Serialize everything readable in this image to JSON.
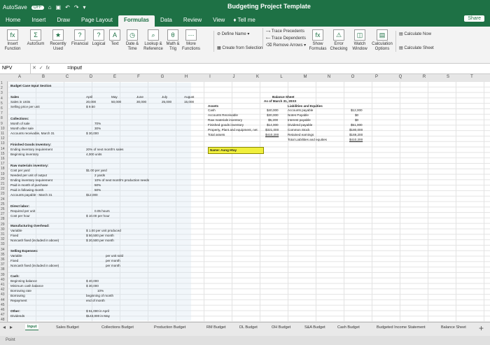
{
  "app": {
    "autosave": "AutoSave",
    "autosave_state": "OFF",
    "title": "Budgeting Project Template"
  },
  "tabs": [
    "Home",
    "Insert",
    "Draw",
    "Page Layout",
    "Formulas",
    "Data",
    "Review",
    "View"
  ],
  "active_tab": "Formulas",
  "tell_me": "Tell me",
  "share": "Share",
  "ribbon": {
    "insert_function": "Insert Function",
    "autosum": "AutoSum",
    "recently_used": "Recently Used",
    "financial": "Financial",
    "logical": "Logical",
    "text": "Text",
    "date_time": "Date & Time",
    "lookup": "Lookup & Reference",
    "math": "Math & Trig",
    "more": "More Functions",
    "define_name": "Define Name",
    "create_from_selection": "Create from Selection",
    "trace_precedents": "Trace Precedents",
    "trace_dependents": "Trace Dependents",
    "remove_arrows": "Remove Arrows",
    "show_formulas": "Show Formulas",
    "error_checking": "Error Checking",
    "watch_window": "Watch Window",
    "calc_options": "Calculation Options",
    "calc_now": "Calculate Now",
    "calc_sheet": "Calculate Sheet"
  },
  "formula_bar": {
    "name_box": "NPV",
    "content": "=Input!"
  },
  "columns": [
    "A",
    "B",
    "C",
    "D",
    "E",
    "F",
    "G",
    "H",
    "I",
    "J",
    "K",
    "L",
    "M",
    "N",
    "O",
    "P",
    "Q",
    "R",
    "S",
    "T"
  ],
  "rows": [
    "1",
    "2",
    "3",
    "4",
    "5",
    "6",
    "7",
    "8",
    "9",
    "10",
    "11",
    "12",
    "13",
    "14",
    "15",
    "16",
    "17",
    "18",
    "19",
    "20",
    "21",
    "22",
    "23",
    "24",
    "25",
    "26",
    "27",
    "28",
    "29",
    "30",
    "31",
    "32",
    "33",
    "34",
    "35",
    "36",
    "37",
    "38",
    "39",
    "40",
    "41",
    "42",
    "43",
    "44",
    "45",
    "46",
    "47",
    "48"
  ],
  "input_section": {
    "title": "Budget Case Input Section",
    "sales": "Sales",
    "sales_in_units": "Sales in Units",
    "selling_price": "Selling price per unit",
    "months": [
      "April",
      "May",
      "June",
      "July",
      "August"
    ],
    "units": [
      "20,000",
      "50,000",
      "30,000",
      "25,000",
      "15,000"
    ],
    "price": "9.50",
    "collections": "Collections:",
    "month_of_sale": "Month of sale",
    "month_after_sale": "Month after sale",
    "ar_march": "Accounts receivable, March 31",
    "collect_pct1": "70%",
    "collect_pct2": "30%",
    "ar_value": "30,000",
    "fg_inventory": "Finished Goods Inventory:",
    "ending_inv_req": "Ending inventory requirement",
    "beginning_inv": "Beginning inventory",
    "fg_pct": "20% of next month's sales",
    "fg_units": "4,000 units",
    "raw_materials": "Raw materials inventory:",
    "cost_per_yard": "Cost per yard",
    "needed_per_unit": "Needed per unit of output",
    "ending_raw_req": "Ending inventory requirement",
    "paid_month": "Paid in month of purchase",
    "paid_following": "Paid in following month",
    "ap_march": "Accounts payable - March 31",
    "rm_cost": "$1.00 per yard",
    "rm_yards": "2 yards",
    "rm_pct": "10% of next month's production needs",
    "rm_paid1": "50%",
    "rm_paid2": "50%",
    "rm_ap": "$12,000",
    "direct_labor": "Direct labor:",
    "required_per_unit": "Required per unit",
    "cost_per_hour": "Cost per hour",
    "dl_hours": "0.05 hours",
    "dl_rate": "10.00 per hour",
    "mfg_overhead": "Manufacturing Overhead:",
    "variable": "Variable",
    "fixed": "Fixed",
    "noncash_fixed": "Noncash fixed (included in above)",
    "oh_var": "1.00 per unit produced",
    "oh_fixed": "50,500 per month",
    "oh_noncash": "20,500 per month",
    "selling_expenses": "Selling Expenses:",
    "se_variable": "Variable",
    "se_fixed": "Fixed",
    "se_noncash": "Noncash fixed (included in above)",
    "se_var_val": "per unit sold",
    "se_fixed_val": "per month",
    "se_noncash_val": "per month",
    "cash": "Cash:",
    "beginning_balance": "Beginning balance",
    "min_cash": "Minimum cash balance",
    "borrowing_rate": "Borrowing rate",
    "borrowing": "Borrowing",
    "repayment": "Repayment",
    "cash_begin": "$ 40,000",
    "cash_min": "$ 30,000",
    "cash_rate": "10%",
    "cash_borrow": "beginning of month",
    "cash_repay": "end of month",
    "other": "Other:",
    "dividends": "Dividends",
    "equipment_purchase": "Equipment purchases",
    "div_val": "$ 51,000 in April",
    "equip_val": "$143,000 in May"
  },
  "balance_sheet": {
    "title": "Balance Sheet",
    "as_of": "As of March 31, 20XX",
    "assets": "Assets",
    "cash": "Cash",
    "ar": "Accounts Receivable",
    "rm_inv": "Raw materials inventory",
    "fg_inv": "Finished goods inventory",
    "ppe": "Property, Plant and equipment, net",
    "total_assets": "Total assets",
    "asset_values": [
      "$40,000",
      "$30,000",
      "$5,200",
      "$14,000",
      "$321,000",
      "$410,200"
    ],
    "liab_header": "Liabilities and Equities",
    "ap": "Accounts payable",
    "notes": "Notes Payable",
    "interest": "Interest payable",
    "dividend_payable": "Dividend payable",
    "common_stock": "Common Stock",
    "retained": "Retained earnings",
    "total_le": "Total Liabilities and equities",
    "liab_values": [
      "$12,000",
      "$0",
      "$0",
      "$51,000",
      "$180,000",
      "$169,200",
      "$410,200"
    ]
  },
  "name_cell": "Name: Aung Htay",
  "sheets": [
    "Input",
    "Sales Budget",
    "Collections Budget",
    "Production Budget",
    "RM Budget",
    "DL Budget",
    "OH Budget",
    "S&A Budget",
    "Cash Budget",
    "Budgeted Income Statement",
    "Balance Sheet"
  ],
  "active_sheet": "Input",
  "status": "Point"
}
